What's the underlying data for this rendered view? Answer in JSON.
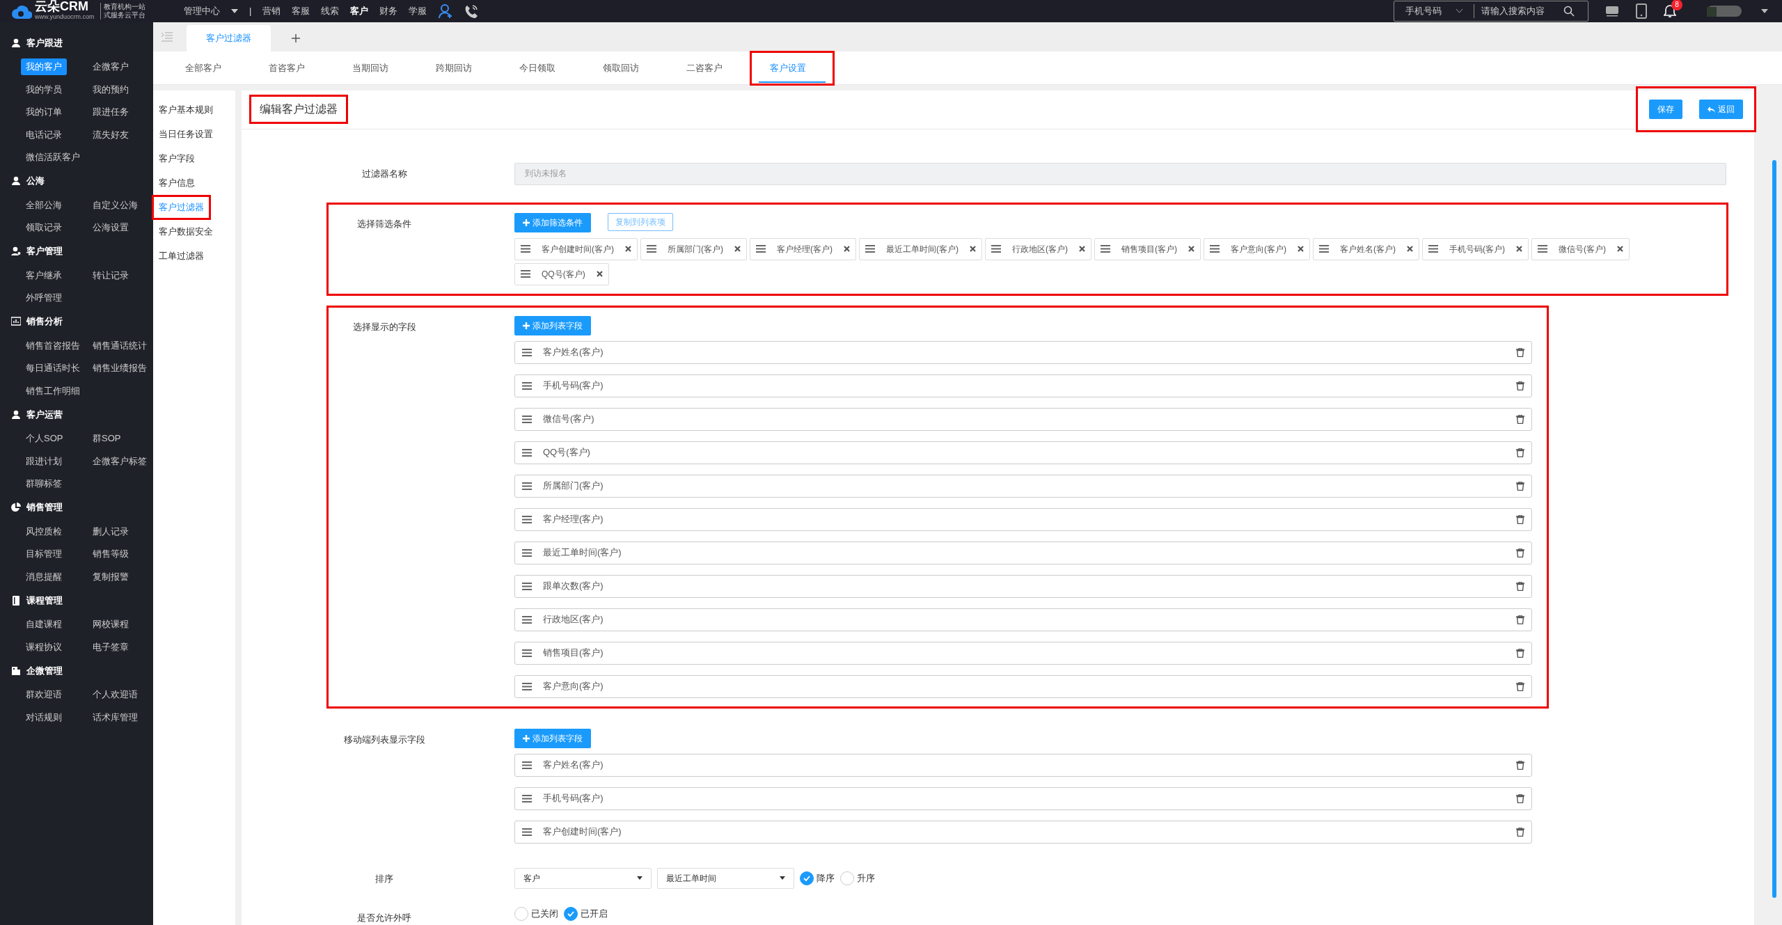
{
  "top_bar": {
    "logo": "云朵CRM",
    "logo_tagline": [
      "教育机构一站",
      "式服务云平台"
    ],
    "logo_url": "www.yunduocrm.com",
    "center_menu": "管理中心",
    "divider": "|",
    "nav": [
      {
        "label": "营销",
        "selected": false
      },
      {
        "label": "客服",
        "selected": false
      },
      {
        "label": "线索",
        "selected": false
      },
      {
        "label": "客户",
        "selected": true
      },
      {
        "label": "财务",
        "selected": false
      },
      {
        "label": "学服",
        "selected": false
      }
    ],
    "search": {
      "type": "手机号码",
      "placeholder": "请输入搜索内容"
    },
    "notification_count": "8"
  },
  "sidebar": {
    "groups": [
      {
        "title": "客户跟进",
        "items": [
          {
            "label": "我的客户",
            "selected": true
          },
          {
            "label": "企微客户",
            "selected": false
          },
          {
            "label": "我的学员",
            "selected": false
          },
          {
            "label": "我的预约",
            "selected": false
          },
          {
            "label": "我的订单",
            "selected": false
          },
          {
            "label": "跟进任务",
            "selected": false
          },
          {
            "label": "电话记录",
            "selected": false
          },
          {
            "label": "流失好友",
            "selected": false
          },
          {
            "label": "微信活跃客户",
            "selected": false
          }
        ]
      },
      {
        "title": "公海",
        "items": [
          {
            "label": "全部公海",
            "selected": false
          },
          {
            "label": "自定义公海",
            "selected": false
          },
          {
            "label": "领取记录",
            "selected": false
          },
          {
            "label": "公海设置",
            "selected": false
          }
        ]
      },
      {
        "title": "客户管理",
        "items": [
          {
            "label": "客户继承",
            "selected": false
          },
          {
            "label": "转让记录",
            "selected": false
          },
          {
            "label": "外呼管理",
            "selected": false
          }
        ]
      },
      {
        "title": "销售分析",
        "items": [
          {
            "label": "销售首咨报告",
            "selected": false
          },
          {
            "label": "销售通话统计",
            "selected": false
          },
          {
            "label": "每日通话时长",
            "selected": false
          },
          {
            "label": "销售业绩报告",
            "selected": false
          },
          {
            "label": "销售工作明细",
            "selected": false
          }
        ]
      },
      {
        "title": "客户运营",
        "items": [
          {
            "label": "个人SOP",
            "selected": false
          },
          {
            "label": "群SOP",
            "selected": false
          },
          {
            "label": "跟进计划",
            "selected": false
          },
          {
            "label": "企微客户标签",
            "selected": false
          },
          {
            "label": "群聊标签",
            "selected": false
          }
        ]
      },
      {
        "title": "销售管理",
        "items": [
          {
            "label": "风控质检",
            "selected": false
          },
          {
            "label": "删人记录",
            "selected": false
          },
          {
            "label": "目标管理",
            "selected": false
          },
          {
            "label": "销售等级",
            "selected": false
          },
          {
            "label": "消息提醒",
            "selected": false
          },
          {
            "label": "复制报警",
            "selected": false
          }
        ]
      },
      {
        "title": "课程管理",
        "items": [
          {
            "label": "自建课程",
            "selected": false
          },
          {
            "label": "网校课程",
            "selected": false
          },
          {
            "label": "课程协议",
            "selected": false
          },
          {
            "label": "电子签章",
            "selected": false
          }
        ]
      },
      {
        "title": "企微管理",
        "items": [
          {
            "label": "群欢迎语",
            "selected": false
          },
          {
            "label": "个人欢迎语",
            "selected": false
          },
          {
            "label": "对话规则",
            "selected": false
          },
          {
            "label": "话术库管理",
            "selected": false
          }
        ]
      }
    ]
  },
  "page_tabs": [
    {
      "label": "客户过滤器",
      "selected": true
    }
  ],
  "sub_tabs": [
    {
      "label": "全部客户",
      "selected": false,
      "highlighted": false
    },
    {
      "label": "首咨客户",
      "selected": false,
      "highlighted": false
    },
    {
      "label": "当期回访",
      "selected": false,
      "highlighted": false
    },
    {
      "label": "跨期回访",
      "selected": false,
      "highlighted": false
    },
    {
      "label": "今日领取",
      "selected": false,
      "highlighted": false
    },
    {
      "label": "领取回访",
      "selected": false,
      "highlighted": false
    },
    {
      "label": "二咨客户",
      "selected": false,
      "highlighted": false
    },
    {
      "label": "客户设置",
      "selected": true,
      "highlighted": true
    }
  ],
  "settings_menu": [
    {
      "label": "客户基本规则",
      "selected": false,
      "highlighted": false
    },
    {
      "label": "当日任务设置",
      "selected": false,
      "highlighted": false
    },
    {
      "label": "客户字段",
      "selected": false,
      "highlighted": false
    },
    {
      "label": "客户信息",
      "selected": false,
      "highlighted": false
    },
    {
      "label": "客户过滤器",
      "selected": true,
      "highlighted": true
    },
    {
      "label": "客户数据安全",
      "selected": false,
      "highlighted": false
    },
    {
      "label": "工单过滤器",
      "selected": false,
      "highlighted": false
    }
  ],
  "editor": {
    "title": "编辑客户过滤器",
    "title_highlighted": true,
    "actions_highlighted": true,
    "buttons": [
      {
        "label": "保存",
        "kind": "save"
      },
      {
        "label": "返回",
        "kind": "back"
      }
    ],
    "rows": [
      {
        "kind": "text",
        "label": "过滤器名称",
        "value": "到访未报名",
        "disabled": true,
        "highlighted": false
      },
      {
        "kind": "tags",
        "label": "选择筛选条件",
        "highlighted": true,
        "add_button": "添加筛选条件",
        "copy_button": "复制到列表项",
        "tags": [
          "客户创建时间(客户)",
          "所属部门(客户)",
          "客户经理(客户)",
          "最近工单时间(客户)",
          "行政地区(客户)",
          "销售项目(客户)",
          "客户意向(客户)",
          "客户姓名(客户)",
          "手机号码(客户)",
          "微信号(客户)",
          "QQ号(客户)"
        ]
      },
      {
        "kind": "list",
        "label": "选择显示的字段",
        "highlighted": true,
        "add_button": "添加列表字段",
        "items": [
          "客户姓名(客户)",
          "手机号码(客户)",
          "微信号(客户)",
          "QQ号(客户)",
          "所属部门(客户)",
          "客户经理(客户)",
          "最近工单时间(客户)",
          "跟单次数(客户)",
          "行政地区(客户)",
          "销售项目(客户)",
          "客户意向(客户)"
        ]
      },
      {
        "kind": "list",
        "label": "移动端列表显示字段",
        "highlighted": false,
        "add_button": "添加列表字段",
        "items": [
          "客户姓名(客户)",
          "手机号码(客户)",
          "客户创建时间(客户)"
        ]
      },
      {
        "kind": "sort",
        "label": "排序",
        "highlighted": false,
        "selects": [
          "客户",
          "最近工单时间"
        ],
        "options": [
          {
            "label": "降序",
            "selected": true
          },
          {
            "label": "升序",
            "selected": false
          }
        ]
      },
      {
        "kind": "radio",
        "label": "是否允许外呼",
        "highlighted": false,
        "options": [
          {
            "label": "已关闭",
            "selected": false
          },
          {
            "label": "已开启",
            "selected": true
          }
        ]
      }
    ]
  }
}
